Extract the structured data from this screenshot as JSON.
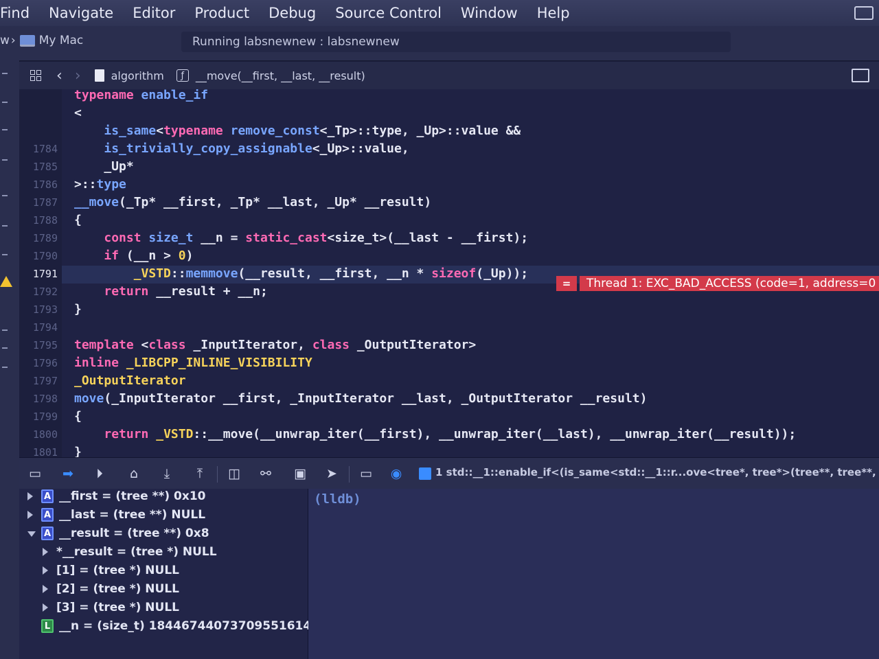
{
  "menubar": {
    "items": [
      "Find",
      "Navigate",
      "Editor",
      "Product",
      "Debug",
      "Source Control",
      "Window",
      "Help"
    ]
  },
  "toolbar": {
    "scheme_prefix": "w",
    "destination": "My Mac",
    "activity": "Running labsnewnew : labsnewnew"
  },
  "jumpbar": {
    "file": "algorithm",
    "function": "__move(__first, __last, __result)"
  },
  "editor": {
    "lines": [
      {
        "n": "",
        "html_key": "l0"
      },
      {
        "n": "",
        "html_key": "l1"
      },
      {
        "n": "",
        "html_key": "l2"
      },
      {
        "n": "1784",
        "html_key": "l3"
      },
      {
        "n": "1785",
        "html_key": "l4"
      },
      {
        "n": "1786",
        "html_key": "l5"
      },
      {
        "n": "1787",
        "html_key": "l6"
      },
      {
        "n": "1788",
        "html_key": "l7"
      },
      {
        "n": "1789",
        "html_key": "l8"
      },
      {
        "n": "1790",
        "html_key": "l9"
      },
      {
        "n": "1791",
        "html_key": "l10"
      },
      {
        "n": "1792",
        "html_key": "l11"
      },
      {
        "n": "1793",
        "html_key": "l12"
      },
      {
        "n": "1794",
        "html_key": "l13"
      },
      {
        "n": "1795",
        "html_key": "l14"
      },
      {
        "n": "1796",
        "html_key": "l15"
      },
      {
        "n": "1797",
        "html_key": "l16"
      },
      {
        "n": "1798",
        "html_key": "l17"
      },
      {
        "n": "1799",
        "html_key": "l18"
      },
      {
        "n": "1800",
        "html_key": "l19"
      },
      {
        "n": "1801",
        "html_key": "l20"
      }
    ],
    "code": {
      "l0": [
        [
          "k",
          "typename"
        ],
        [
          "p",
          " "
        ],
        [
          "t",
          "enable_if"
        ]
      ],
      "l1": [
        [
          "p",
          "<"
        ]
      ],
      "l2": [
        [
          "p",
          "    "
        ],
        [
          "t",
          "is_same"
        ],
        [
          "p",
          "<"
        ],
        [
          "k",
          "typename"
        ],
        [
          "p",
          " "
        ],
        [
          "t",
          "remove_const"
        ],
        [
          "p",
          "<_Tp>::type, _Up>::value &&"
        ]
      ],
      "l3": [
        [
          "p",
          "    "
        ],
        [
          "t",
          "is_trivially_copy_assignable"
        ],
        [
          "p",
          "<_Up>::value,"
        ]
      ],
      "l4": [
        [
          "p",
          "    _Up*"
        ]
      ],
      "l5": [
        [
          "p",
          ">::"
        ],
        [
          "t",
          "type"
        ]
      ],
      "l6": [
        [
          "t",
          "__move"
        ],
        [
          "p",
          "(_Tp* __first, _Tp* __last, _Up* __result)"
        ]
      ],
      "l7": [
        [
          "p",
          "{"
        ]
      ],
      "l8": [
        [
          "p",
          "    "
        ],
        [
          "k",
          "const"
        ],
        [
          "p",
          " "
        ],
        [
          "t",
          "size_t"
        ],
        [
          "p",
          " __n = "
        ],
        [
          "k",
          "static_cast"
        ],
        [
          "p",
          "<size_t>(__last - __first);"
        ]
      ],
      "l9": [
        [
          "p",
          "    "
        ],
        [
          "k",
          "if"
        ],
        [
          "p",
          " (__n > "
        ],
        [
          "n",
          "0"
        ],
        [
          "p",
          ")"
        ]
      ],
      "l10": [
        [
          "p",
          "        "
        ],
        [
          "m",
          "_VSTD"
        ],
        [
          "p",
          "::"
        ],
        [
          "t",
          "memmove"
        ],
        [
          "p",
          "(__result, __first, __n * "
        ],
        [
          "k",
          "sizeof"
        ],
        [
          "p",
          "(_Up));"
        ]
      ],
      "l11": [
        [
          "p",
          "    "
        ],
        [
          "k",
          "return"
        ],
        [
          "p",
          " __result + __n;"
        ]
      ],
      "l12": [
        [
          "p",
          "}"
        ]
      ],
      "l13": [
        [
          "p",
          ""
        ]
      ],
      "l14": [
        [
          "k",
          "template"
        ],
        [
          "p",
          " <"
        ],
        [
          "k",
          "class"
        ],
        [
          "p",
          " _InputIterator, "
        ],
        [
          "k",
          "class"
        ],
        [
          "p",
          " _OutputIterator>"
        ]
      ],
      "l15": [
        [
          "k",
          "inline"
        ],
        [
          "p",
          " "
        ],
        [
          "m",
          "_LIBCPP_INLINE_VISIBILITY"
        ]
      ],
      "l16": [
        [
          "m",
          "_OutputIterator"
        ]
      ],
      "l17": [
        [
          "t",
          "move"
        ],
        [
          "p",
          "(_InputIterator __first, _InputIterator __last, _OutputIterator __result)"
        ]
      ],
      "l18": [
        [
          "p",
          "{"
        ]
      ],
      "l19": [
        [
          "p",
          "    "
        ],
        [
          "k",
          "return"
        ],
        [
          "p",
          " "
        ],
        [
          "m",
          "_VSTD"
        ],
        [
          "p",
          "::__move(__unwrap_iter(__first), __unwrap_iter(__last), __unwrap_iter(__result));"
        ]
      ],
      "l20": [
        [
          "p",
          "}"
        ]
      ]
    },
    "current_line_number": "1791",
    "error_badge": "=",
    "error_message": "Thread 1: EXC_BAD_ACCESS (code=1, address=0"
  },
  "debugbar": {
    "frame": "1 std::__1::enable_if<(is_same<std::__1::r...ove<tree*, tree*>(tree**, tree**, tree**"
  },
  "variables": [
    {
      "badge": "A",
      "name": "__first",
      "value": " = (tree **) 0x10",
      "expand": "right",
      "indent": 0
    },
    {
      "badge": "A",
      "name": "__last",
      "value": " = (tree **) NULL",
      "expand": "right",
      "indent": 0
    },
    {
      "badge": "A",
      "name": "__result",
      "value": " = (tree **) 0x8",
      "expand": "down",
      "indent": 0
    },
    {
      "badge": "",
      "name": "*__result",
      "value": " = (tree *) NULL",
      "expand": "right",
      "indent": 1
    },
    {
      "badge": "",
      "name": "[1]",
      "value": " = (tree *) NULL",
      "expand": "right",
      "indent": 1
    },
    {
      "badge": "",
      "name": "[2]",
      "value": " = (tree *) NULL",
      "expand": "right",
      "indent": 1
    },
    {
      "badge": "",
      "name": "[3]",
      "value": " = (tree *) NULL",
      "expand": "right",
      "indent": 1
    },
    {
      "badge": "L",
      "name": "__n",
      "value": " = (size_t) 18446744073709551614",
      "expand": "",
      "indent": 0
    }
  ],
  "console": {
    "prompt": "(lldb)"
  }
}
